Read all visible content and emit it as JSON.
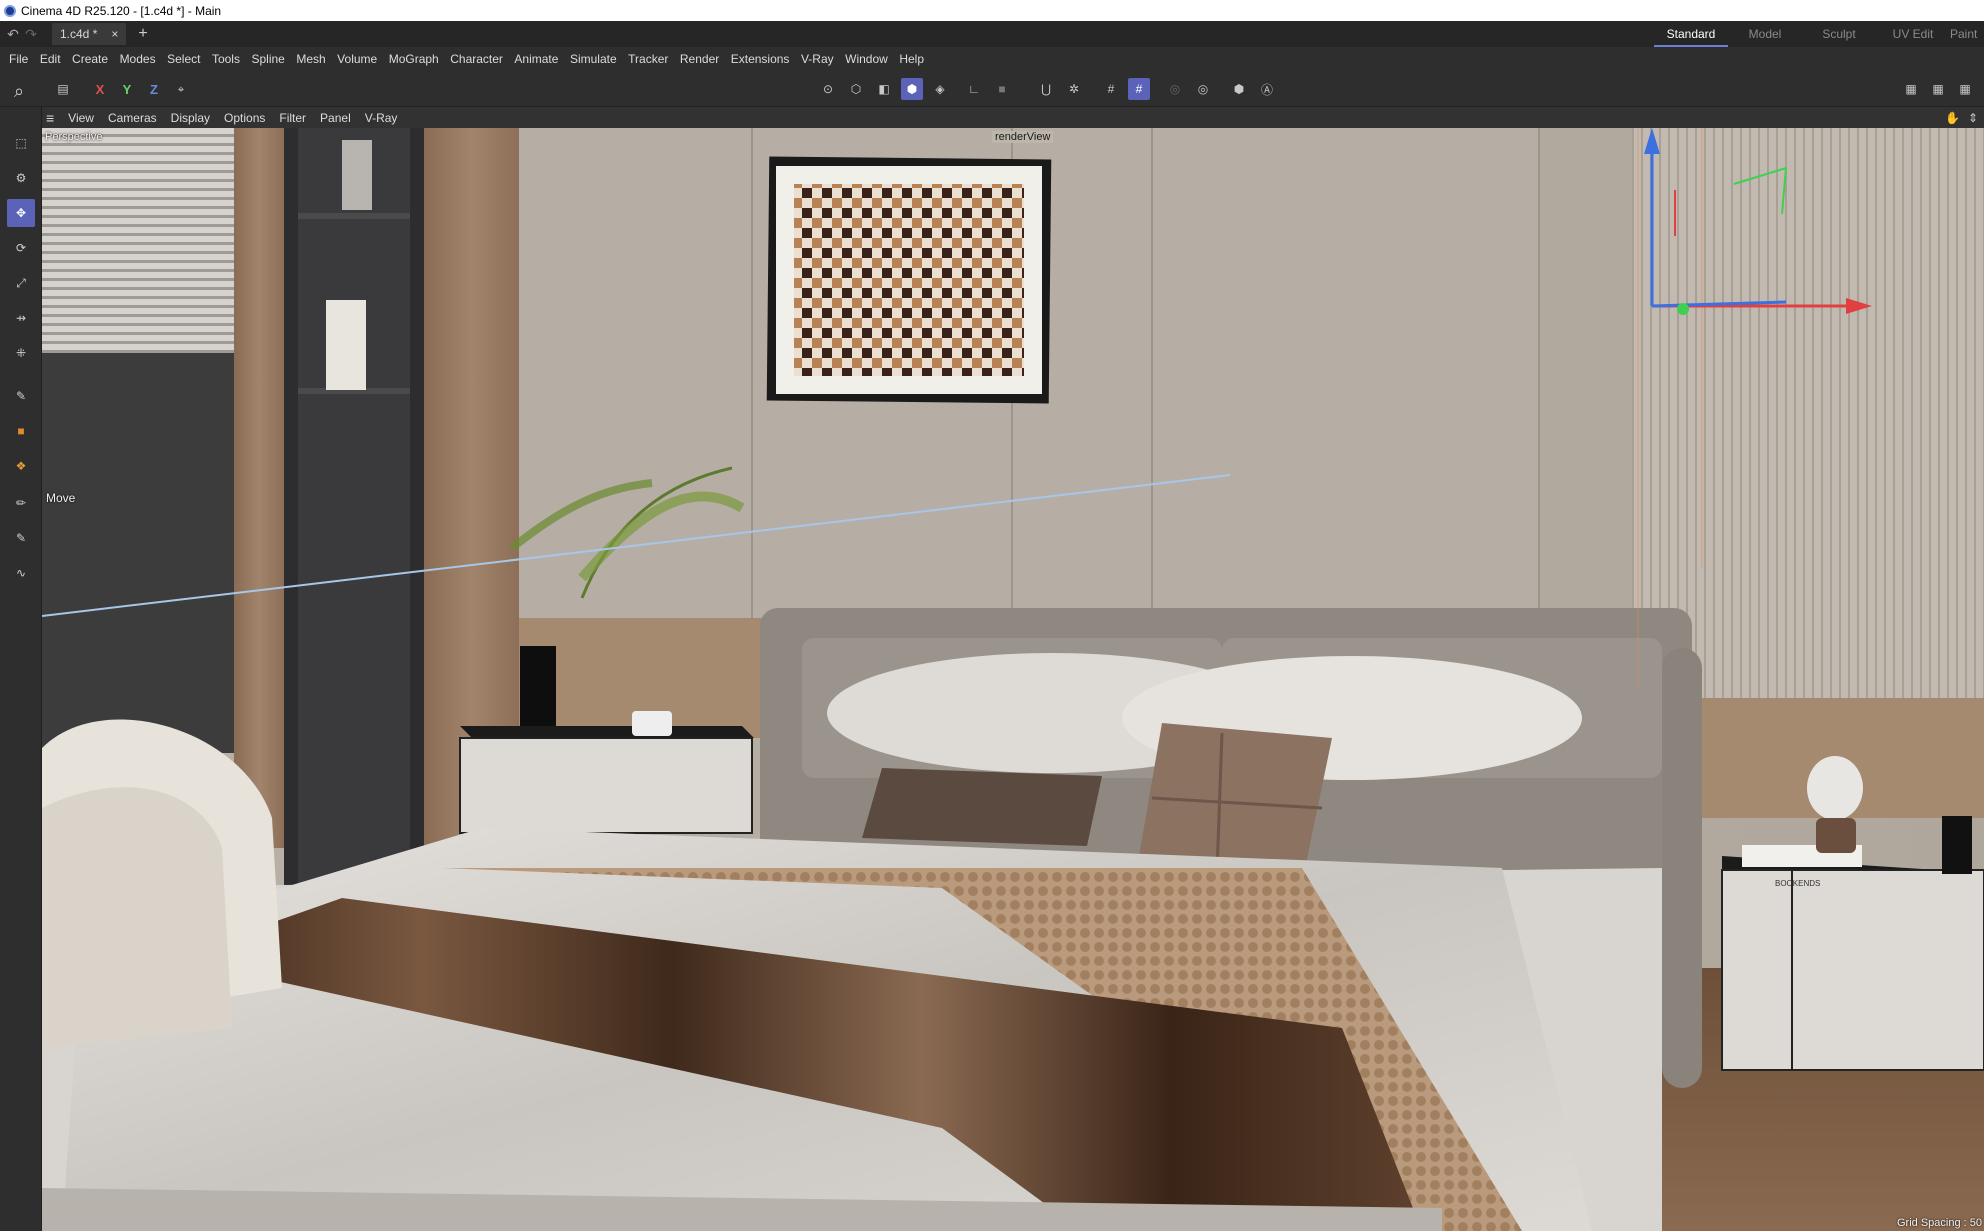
{
  "window": {
    "title": "Cinema 4D R25.120 - [1.c4d *] - Main"
  },
  "tabs": {
    "doc_tab": "1.c4d *",
    "close": "×",
    "add": "+"
  },
  "layouts": [
    "Standard",
    "Model",
    "Sculpt",
    "UV Edit",
    "Paint"
  ],
  "menu": [
    "File",
    "Edit",
    "Create",
    "Modes",
    "Select",
    "Tools",
    "Spline",
    "Mesh",
    "Volume",
    "MoGraph",
    "Character",
    "Animate",
    "Simulate",
    "Tracker",
    "Render",
    "Extensions",
    "V-Ray",
    "Window",
    "Help"
  ],
  "toolbar": {
    "axis_x": "X",
    "axis_y": "Y",
    "axis_z": "Z"
  },
  "viewport_menu": [
    "View",
    "Cameras",
    "Display",
    "Options",
    "Filter",
    "Panel",
    "V-Ray"
  ],
  "viewport": {
    "camera_label": "Perspective",
    "render_view_label": "renderView",
    "tool_label": "Move",
    "grid_spacing": "Grid Spacing : 50",
    "nightstand_book_text": "BOOKENDS"
  },
  "colors": {
    "accent": "#5a63b8",
    "axis_x": "#e04040",
    "axis_y": "#3fd04f",
    "axis_z": "#3c6fe0"
  }
}
